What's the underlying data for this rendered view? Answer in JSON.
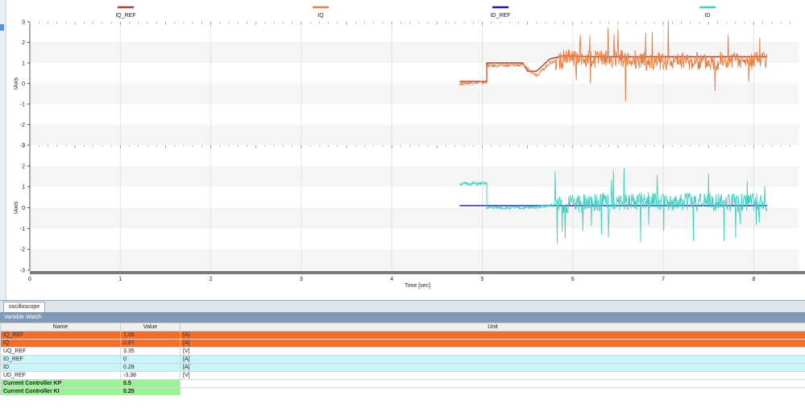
{
  "scope": {
    "legend": [
      {
        "name": "IQ_REF",
        "color": "#c0392b"
      },
      {
        "name": "IQ",
        "color": "#e87d3e"
      },
      {
        "name": "ID_REF",
        "color": "#1a1aa6"
      },
      {
        "name": "ID",
        "color": "#40d0c4"
      }
    ],
    "x_axis_label": "Time [sec]",
    "x_ticks": [
      "0",
      "1",
      "2",
      "3",
      "4",
      "5",
      "6",
      "7",
      "8"
    ],
    "y_ticks": [
      "3",
      "2",
      "1",
      "0",
      "-1",
      "-2",
      "-3"
    ],
    "top_plot_ylabel": "IAxis",
    "bottom_plot_ylabel": "IAxis",
    "chart_data": [
      {
        "type": "line",
        "xlim": [
          0,
          8.5
        ],
        "ylim": [
          -3,
          3
        ],
        "ylabel": "IAxis",
        "grid": true,
        "series": [
          {
            "name": "IQ_REF",
            "color": "#c0392b",
            "x": [
              4.75,
              4.95,
              5.05,
              5.05,
              5.45,
              5.5,
              5.6,
              5.75,
              5.9,
              6.2,
              6.6,
              7.0,
              7.4,
              7.8,
              8.15
            ],
            "y": [
              0.1,
              0.1,
              0.1,
              1.0,
              1.0,
              0.6,
              0.6,
              1.2,
              1.35,
              1.3,
              1.3,
              1.3,
              1.3,
              1.3,
              1.3
            ]
          },
          {
            "name": "IQ",
            "color": "#e87d3e",
            "x": [
              4.75,
              4.95,
              5.05,
              5.05,
              5.45,
              5.6,
              5.75,
              5.9,
              6.2,
              6.6,
              7.0,
              7.4,
              7.8,
              8.15
            ],
            "y": [
              0.0,
              0.05,
              0.05,
              0.85,
              0.9,
              0.4,
              1.0,
              1.2,
              1.2,
              1.2,
              1.1,
              1.1,
              1.1,
              1.1
            ]
          }
        ]
      },
      {
        "type": "line",
        "xlim": [
          0,
          8.5
        ],
        "ylim": [
          -3,
          3
        ],
        "ylabel": "IAxis",
        "grid": true,
        "series": [
          {
            "name": "ID_REF",
            "color": "#1a1aa6",
            "x": [
              4.75,
              8.15
            ],
            "y": [
              0.1,
              0.1
            ]
          },
          {
            "name": "ID",
            "color": "#40d0c4",
            "x": [
              4.75,
              5.05,
              5.05,
              5.5,
              6.0,
              6.5,
              7.0,
              7.5,
              8.15
            ],
            "y": [
              1.15,
              1.15,
              0.0,
              0.0,
              0.2,
              0.3,
              0.3,
              0.25,
              0.25
            ]
          }
        ]
      }
    ]
  },
  "tab_label": "oscilloscope",
  "watch": {
    "title": "Variable Watch",
    "headers": {
      "name": "Name",
      "value": "Value",
      "unit": "Unit"
    },
    "rows": [
      {
        "name": "IQ_REF",
        "value": "1.06",
        "unit": "[A]",
        "style": "orange"
      },
      {
        "name": "IQ",
        "value": "0.87",
        "unit": "[A]",
        "style": "orange"
      },
      {
        "name": "UQ_REF",
        "value": "3.35",
        "unit": "[V]",
        "style": "plain"
      },
      {
        "name": "ID_REF",
        "value": "0",
        "unit": "[A]",
        "style": "cyan"
      },
      {
        "name": "ID",
        "value": "0.28",
        "unit": "[A]",
        "style": "cyan"
      },
      {
        "name": "UD_REF",
        "value": "-3.38",
        "unit": "[V]",
        "style": "plain"
      },
      {
        "name": "Current Controller KP",
        "value": "0.5",
        "unit": "",
        "style": "green"
      },
      {
        "name": "Current Controller KI",
        "value": "0.25",
        "unit": "",
        "style": "green"
      }
    ]
  }
}
